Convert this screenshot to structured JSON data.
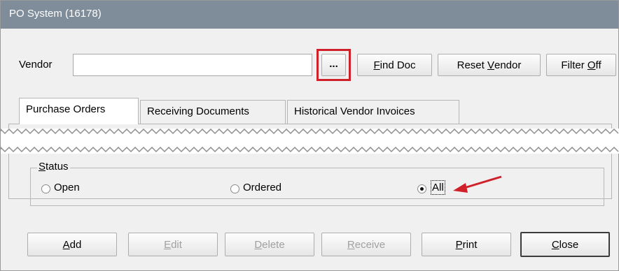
{
  "window": {
    "title": "PO System (16178)"
  },
  "vendor": {
    "label": "Vendor",
    "value": ""
  },
  "buttons": {
    "browse": "...",
    "find_doc": {
      "mnemonic": "F",
      "rest": "ind Doc"
    },
    "reset_vendor": {
      "pre": "Reset ",
      "mnemonic": "V",
      "rest": "endor"
    },
    "filter_off": {
      "pre": "Filter ",
      "mnemonic": "O",
      "rest": "ff"
    }
  },
  "tabs": [
    {
      "label": "Purchase Orders",
      "active": true
    },
    {
      "label": "Receiving Documents",
      "active": false
    },
    {
      "label": "Historical Vendor Invoices",
      "active": false
    }
  ],
  "status": {
    "title_mnemonic": "S",
    "title_rest": "tatus",
    "options": [
      {
        "label": "Open",
        "selected": false
      },
      {
        "label": "Ordered",
        "selected": false
      },
      {
        "label": "All",
        "selected": true
      }
    ]
  },
  "actions": {
    "add": {
      "mnemonic": "A",
      "rest": "dd",
      "enabled": true
    },
    "edit": {
      "mnemonic": "E",
      "rest": "dit",
      "enabled": false
    },
    "delete": {
      "mnemonic": "D",
      "rest": "elete",
      "enabled": false
    },
    "receive": {
      "mnemonic": "R",
      "rest": "eceive",
      "enabled": false
    },
    "print": {
      "mnemonic": "P",
      "rest": "rint",
      "enabled": true
    },
    "close": {
      "mnemonic": "C",
      "rest": "lose",
      "enabled": true
    }
  },
  "colors": {
    "titlebar": "#7f8c99",
    "highlight": "#d0202a",
    "disabled_text": "#a0a0a0"
  }
}
